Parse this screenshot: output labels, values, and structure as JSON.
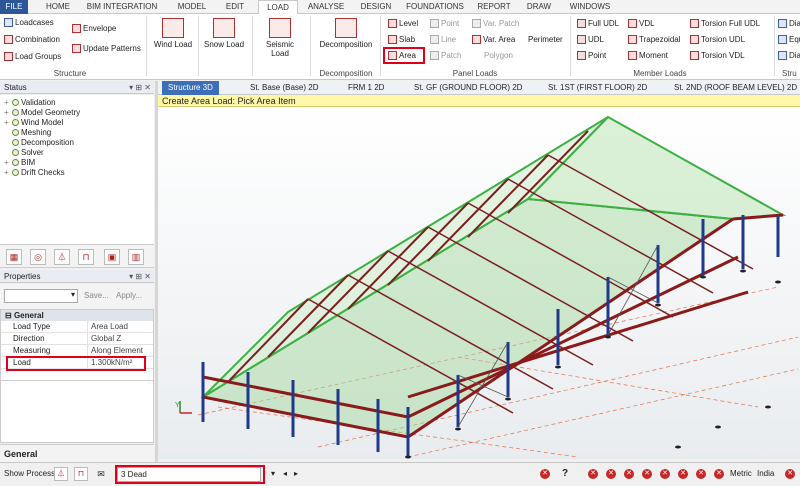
{
  "menu": [
    "FILE",
    "HOME",
    "BIM INTEGRATION",
    "MODEL",
    "EDIT",
    "LOAD",
    "ANALYSE",
    "DESIGN",
    "FOUNDATIONS",
    "REPORT",
    "DRAW",
    "WINDOWS"
  ],
  "ribbon": {
    "structure": {
      "loadcases": "Loadcases",
      "envelope": "Envelope",
      "combination": "Combination",
      "load_groups": "Load Groups",
      "update_patterns": "Update Patterns",
      "group": "Structure"
    },
    "wind": "Wind Load",
    "snow": "Snow Load",
    "seismic": "Seismic Load",
    "decomposition": {
      "label": "Decomposition",
      "group": "Decomposition"
    },
    "panel_loads": {
      "level": "Level",
      "slab": "Slab",
      "area": "Area",
      "point": "Point",
      "line": "Line",
      "patch": "Patch",
      "var_patch": "Var. Patch",
      "var_area": "Var. Area",
      "polygon": "Polygon",
      "perimeter": "Perimeter",
      "group": "Panel Loads"
    },
    "member_loads": {
      "full_udl": "Full UDL",
      "udl": "UDL",
      "point": "Point",
      "vdl": "VDL",
      "trapezoidal": "Trapezoidal",
      "moment": "Moment",
      "torsion_full_udl": "Torsion Full UDL",
      "torsion_udl": "Torsion UDL",
      "torsion_vdl": "Torsion VDL",
      "group": "Member Loads"
    },
    "extra": {
      "diaph1": "Diaph",
      "equip": "Equip",
      "diaph2": "Diaph",
      "group": "Stru"
    }
  },
  "status_panel": {
    "title": "Status",
    "items": [
      "Validation",
      "Model Geometry",
      "Wind Model",
      "Meshing",
      "Decomposition",
      "Solver",
      "BIM",
      "Drift Checks"
    ]
  },
  "properties": {
    "title": "Properties",
    "save": "Save...",
    "apply": "Apply...",
    "category": "General",
    "rows": [
      {
        "k": "Load Type",
        "v": "Area Load"
      },
      {
        "k": "Direction",
        "v": "Global Z"
      },
      {
        "k": "Measuring",
        "v": "Along Element"
      },
      {
        "k": "Load",
        "v": "1.300kN/m²"
      }
    ],
    "footer": "General"
  },
  "view_tabs": [
    "Structure 3D",
    "St. Base (Base) 2D",
    "FRM 1 2D",
    "St. GF (GROUND FLOOR) 2D",
    "St. 1ST (FIRST FLOOR) 2D",
    "St. 2ND (ROOF BEAM LEVEL) 2D"
  ],
  "prompt": "Create Area Load: Pick Area Item",
  "statusbar": {
    "show_process": "Show Process",
    "loadcase": "3 Dead",
    "help": "?",
    "units": "Metric",
    "region": "India"
  },
  "colors": {
    "accent": "#2b579a",
    "highlight": "#e0001b",
    "roof": "#3cb043",
    "column": "#1f3a8a",
    "beam": "#8b1a1a"
  }
}
